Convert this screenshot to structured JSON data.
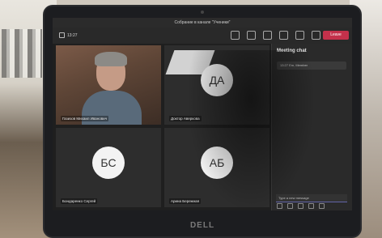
{
  "window": {
    "title": "Собрание в канале \"Ученики\""
  },
  "toolbar": {
    "timer": "13:27",
    "leave_label": "Leave"
  },
  "participants": [
    {
      "name": "Газизов Михаил Иванович",
      "initials": ""
    },
    {
      "name": "Доктор Аверкова",
      "initials": "ДА"
    },
    {
      "name": "Бондаренко Сергей",
      "initials": "БС"
    },
    {
      "name": "Арина Бережная",
      "initials": "АБ"
    }
  ],
  "chat": {
    "title": "Meeting chat",
    "item": "13:27 Em, Member",
    "input_placeholder": "Type a new message"
  },
  "device": {
    "logo": "DELL"
  }
}
